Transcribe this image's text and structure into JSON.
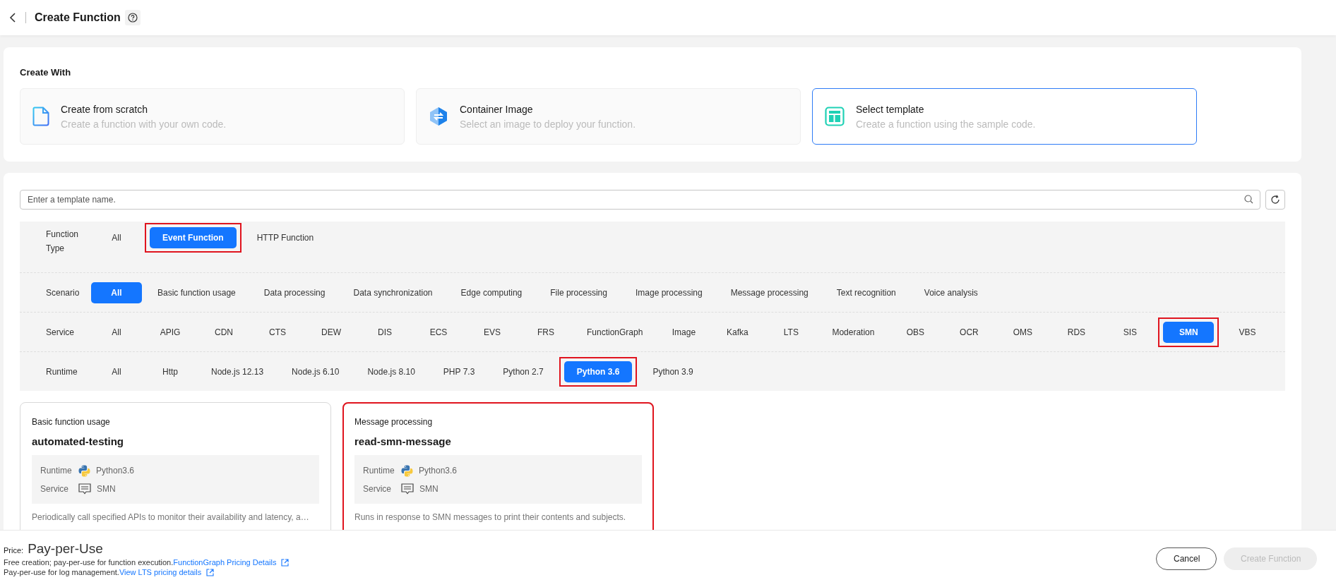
{
  "header": {
    "title": "Create Function"
  },
  "create_with": {
    "title": "Create With",
    "options": [
      {
        "kind": "scratch",
        "title": "Create from scratch",
        "description": "Create a function with your own code.",
        "selected": false
      },
      {
        "kind": "container",
        "title": "Container Image",
        "description": "Select an image to deploy your function.",
        "selected": false
      },
      {
        "kind": "template",
        "title": "Select template",
        "description": "Create a function using the sample code.",
        "selected": true
      }
    ]
  },
  "search": {
    "placeholder": "Enter a template name."
  },
  "filters": [
    {
      "label": "Function Type",
      "options": [
        {
          "label": "All",
          "selected": false,
          "highlighted": false
        },
        {
          "label": "Event Function",
          "selected": true,
          "highlighted": true
        },
        {
          "label": "HTTP Function",
          "selected": false,
          "highlighted": false
        }
      ]
    },
    {
      "label": "Scenario",
      "options": [
        {
          "label": "All",
          "selected": true,
          "highlighted": false
        },
        {
          "label": "Basic function usage",
          "selected": false,
          "highlighted": false
        },
        {
          "label": "Data processing",
          "selected": false,
          "highlighted": false
        },
        {
          "label": "Data synchronization",
          "selected": false,
          "highlighted": false
        },
        {
          "label": "Edge computing",
          "selected": false,
          "highlighted": false
        },
        {
          "label": "File processing",
          "selected": false,
          "highlighted": false
        },
        {
          "label": "Image processing",
          "selected": false,
          "highlighted": false
        },
        {
          "label": "Message processing",
          "selected": false,
          "highlighted": false
        },
        {
          "label": "Text recognition",
          "selected": false,
          "highlighted": false
        },
        {
          "label": "Voice analysis",
          "selected": false,
          "highlighted": false
        }
      ]
    },
    {
      "label": "Service",
      "options": [
        {
          "label": "All",
          "selected": false,
          "highlighted": false
        },
        {
          "label": "APIG",
          "selected": false,
          "highlighted": false
        },
        {
          "label": "CDN",
          "selected": false,
          "highlighted": false
        },
        {
          "label": "CTS",
          "selected": false,
          "highlighted": false
        },
        {
          "label": "DEW",
          "selected": false,
          "highlighted": false
        },
        {
          "label": "DIS",
          "selected": false,
          "highlighted": false
        },
        {
          "label": "ECS",
          "selected": false,
          "highlighted": false
        },
        {
          "label": "EVS",
          "selected": false,
          "highlighted": false
        },
        {
          "label": "FRS",
          "selected": false,
          "highlighted": false
        },
        {
          "label": "FunctionGraph",
          "selected": false,
          "highlighted": false
        },
        {
          "label": "Image",
          "selected": false,
          "highlighted": false
        },
        {
          "label": "Kafka",
          "selected": false,
          "highlighted": false
        },
        {
          "label": "LTS",
          "selected": false,
          "highlighted": false
        },
        {
          "label": "Moderation",
          "selected": false,
          "highlighted": false
        },
        {
          "label": "OBS",
          "selected": false,
          "highlighted": false
        },
        {
          "label": "OCR",
          "selected": false,
          "highlighted": false
        },
        {
          "label": "OMS",
          "selected": false,
          "highlighted": false
        },
        {
          "label": "RDS",
          "selected": false,
          "highlighted": false
        },
        {
          "label": "SIS",
          "selected": false,
          "highlighted": false
        },
        {
          "label": "SMN",
          "selected": true,
          "highlighted": true
        },
        {
          "label": "VBS",
          "selected": false,
          "highlighted": false
        }
      ]
    },
    {
      "label": "Runtime",
      "options": [
        {
          "label": "All",
          "selected": false,
          "highlighted": false
        },
        {
          "label": "Http",
          "selected": false,
          "highlighted": false
        },
        {
          "label": "Node.js 12.13",
          "selected": false,
          "highlighted": false
        },
        {
          "label": "Node.js 6.10",
          "selected": false,
          "highlighted": false
        },
        {
          "label": "Node.js 8.10",
          "selected": false,
          "highlighted": false
        },
        {
          "label": "PHP 7.3",
          "selected": false,
          "highlighted": false
        },
        {
          "label": "Python 2.7",
          "selected": false,
          "highlighted": false
        },
        {
          "label": "Python 3.6",
          "selected": true,
          "highlighted": true
        },
        {
          "label": "Python 3.9",
          "selected": false,
          "highlighted": false
        }
      ]
    }
  ],
  "templates": [
    {
      "category": "Basic function usage",
      "name": "automated-testing",
      "runtime_label": "Runtime",
      "runtime": "Python3.6",
      "service_label": "Service",
      "service": "SMN",
      "description": "Periodically call specified APIs to monitor their availability and latency, a…",
      "highlighted": false
    },
    {
      "category": "Message processing",
      "name": "read-smn-message",
      "runtime_label": "Runtime",
      "runtime": "Python3.6",
      "service_label": "Service",
      "service": "SMN",
      "description": "Runs in response to SMN messages to print their contents and subjects.",
      "highlighted": true
    }
  ],
  "footer": {
    "price_label": "Price:",
    "price": "Pay-per-Use",
    "lines": [
      {
        "text": "Free creation; pay-per-use for function execution.",
        "link": "FunctionGraph Pricing Details"
      },
      {
        "text": "Pay-per-use for log management.",
        "link": "View LTS pricing details"
      }
    ]
  },
  "buttons": [
    {
      "label": "Cancel",
      "kind": "secondary",
      "disabled": false
    },
    {
      "label": "Create Function",
      "kind": "primary",
      "disabled": true
    }
  ]
}
